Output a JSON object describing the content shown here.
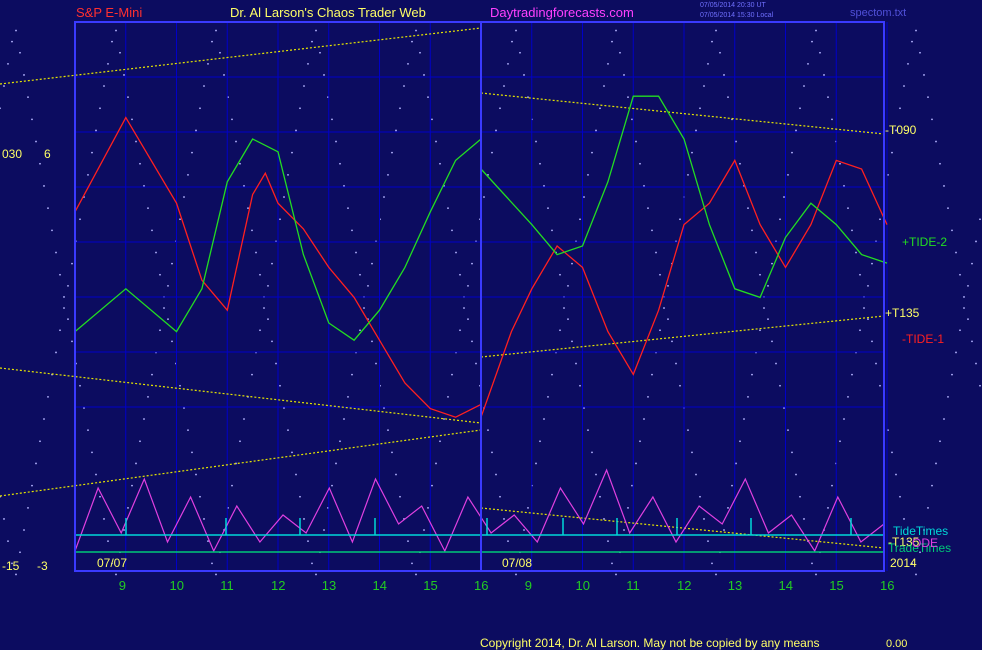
{
  "header": {
    "symbol": "S&P E-Mini",
    "title": "Dr. Al Larson's Chaos Trader Web",
    "site": "Daytradingforecasts.com",
    "stamp_utc": "07/05/2014 20:30 UT",
    "stamp_local": "07/05/2014 15:30 Local",
    "file": "spectom.txt"
  },
  "footer": {
    "copyright": "Copyright 2014, Dr. Al Larson. May not be copied by any means",
    "corner": "0.00"
  },
  "left_scale": {
    "top_labels": [
      "030",
      "6"
    ],
    "bottom_labels": [
      "-15",
      "-3"
    ]
  },
  "colors": {
    "background": "#0c0c60",
    "plot_border": "#3a3aff",
    "grid": "#0000c8",
    "tide1": "#ff2020",
    "tide2": "#22dd22",
    "projection": "#e6e600",
    "spectrum": "#e040e0",
    "tidetimes": "#00d8d8",
    "tradetimes": "#00c878",
    "wave_dots": "#b4b4ff",
    "text_header_red": "#ff3030",
    "text_header_yellow": "#ffff66",
    "text_site": "#ff40ff",
    "axis_hours": "#22cc22"
  },
  "chart_data": {
    "type": "line",
    "x_range": [
      8,
      16
    ],
    "day_ticks": [
      {
        "day": "07/07",
        "hours": [
          9,
          10,
          11,
          12,
          13,
          14,
          15,
          16
        ]
      },
      {
        "day": "07/08",
        "hours": [
          9,
          10,
          11,
          12,
          13,
          14,
          15,
          16
        ]
      }
    ],
    "year_label": "2014",
    "y_range": [
      0,
      100
    ],
    "grid": true,
    "right_labels": [
      "-T090",
      "+TIDE-2",
      "+T135",
      "-TIDE-1",
      "TideTimes",
      "-T135",
      "TradeTimes",
      "ODE"
    ],
    "series": [
      {
        "name": "-TIDE-1",
        "panel": "price",
        "day1": [
          [
            0,
            58
          ],
          [
            1,
            80
          ],
          [
            2,
            60
          ],
          [
            2.5,
            42
          ],
          [
            3,
            35
          ],
          [
            3.5,
            62
          ],
          [
            3.75,
            67
          ],
          [
            4,
            60
          ],
          [
            4.5,
            54
          ],
          [
            5,
            45
          ],
          [
            5.5,
            38
          ],
          [
            6,
            28
          ],
          [
            6.5,
            18
          ],
          [
            7,
            12
          ],
          [
            7.5,
            10
          ],
          [
            8,
            13
          ]
        ],
        "day2": [
          [
            0,
            10
          ],
          [
            0.6,
            30
          ],
          [
            1,
            40
          ],
          [
            1.5,
            50
          ],
          [
            2,
            45
          ],
          [
            2.5,
            30
          ],
          [
            3,
            20
          ],
          [
            3.5,
            35
          ],
          [
            4,
            55
          ],
          [
            4.5,
            60
          ],
          [
            5,
            70
          ],
          [
            5.5,
            55
          ],
          [
            6,
            45
          ],
          [
            6.5,
            55
          ],
          [
            7,
            70
          ],
          [
            7.5,
            68
          ],
          [
            8,
            55
          ]
        ]
      },
      {
        "name": "+TIDE-2",
        "panel": "price",
        "day1": [
          [
            0,
            30
          ],
          [
            1,
            40
          ],
          [
            2,
            30
          ],
          [
            2.5,
            40
          ],
          [
            3,
            65
          ],
          [
            3.5,
            75
          ],
          [
            4,
            72
          ],
          [
            4.5,
            48
          ],
          [
            5,
            32
          ],
          [
            5.5,
            28
          ],
          [
            6,
            35
          ],
          [
            6.5,
            45
          ],
          [
            7,
            58
          ],
          [
            7.5,
            70
          ],
          [
            8,
            75
          ]
        ],
        "day2": [
          [
            0,
            68
          ],
          [
            1,
            55
          ],
          [
            1.5,
            48
          ],
          [
            2,
            50
          ],
          [
            2.5,
            65
          ],
          [
            3,
            85
          ],
          [
            3.5,
            85
          ],
          [
            4,
            75
          ],
          [
            4.5,
            55
          ],
          [
            5,
            40
          ],
          [
            5.5,
            38
          ],
          [
            6,
            52
          ],
          [
            6.5,
            60
          ],
          [
            7,
            55
          ],
          [
            7.5,
            48
          ],
          [
            8,
            46
          ]
        ]
      },
      {
        "name": "Spectrum",
        "panel": "lower",
        "values": [
          1,
          8,
          3,
          9,
          2,
          7,
          1,
          6,
          2,
          5,
          3,
          8,
          2,
          9,
          4,
          6,
          1,
          7,
          3,
          5,
          2,
          8,
          4,
          10,
          3,
          7,
          2,
          6,
          4,
          9,
          3,
          5,
          1,
          7,
          2,
          4
        ]
      }
    ]
  }
}
